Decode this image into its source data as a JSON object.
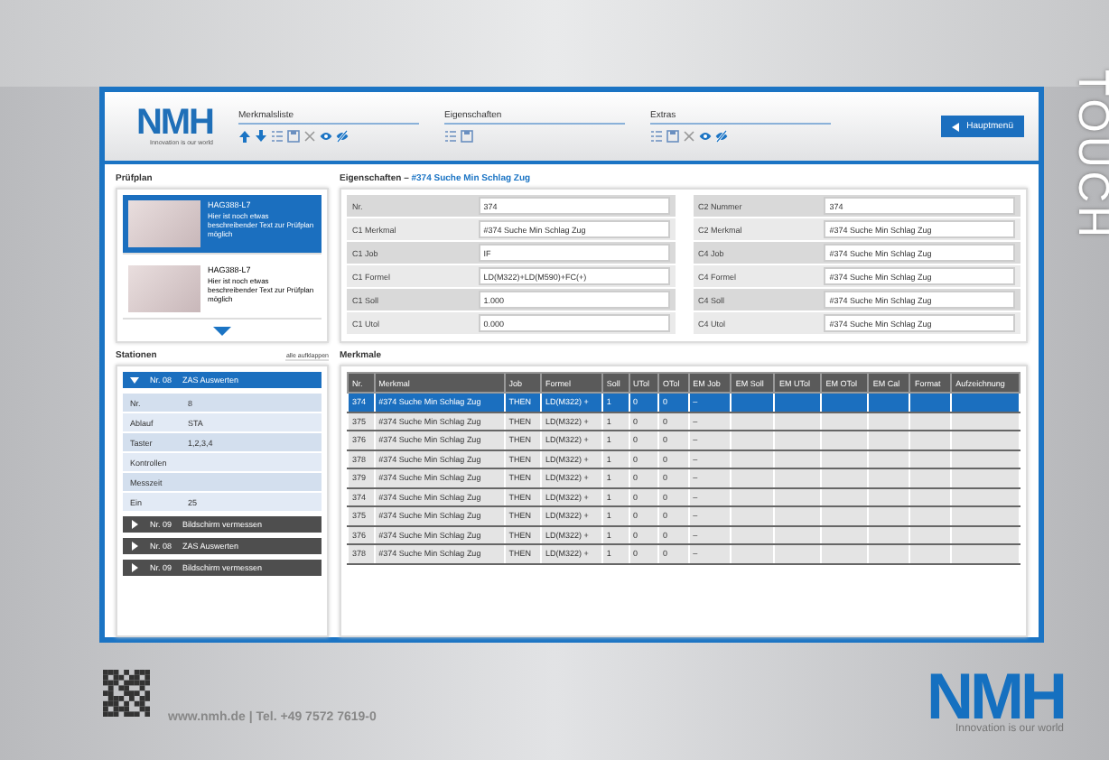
{
  "side_label": "TOUCH",
  "header": {
    "logo": "NMH",
    "tagline": "Innovation is our world",
    "groups": [
      {
        "label": "Merkmalsliste"
      },
      {
        "label": "Eigenschaften"
      },
      {
        "label": "Extras"
      }
    ],
    "main_button": "Hauptmenü"
  },
  "pruefplan": {
    "title": "Prüfplan",
    "items": [
      {
        "code": "HAG388-L7",
        "text": "Hier ist noch etwas beschreibender Text zur Prüfplan möglich",
        "selected": true
      },
      {
        "code": "HAG388-L7",
        "text": "Hier ist noch etwas beschreibender Text zur Prüfplan möglich",
        "selected": false
      }
    ]
  },
  "eigenschaften": {
    "title": "Eigenschaften – ",
    "subject": "#374 Suche Min Schlag Zug",
    "left": [
      {
        "label": "Nr.",
        "value": "374"
      },
      {
        "label": "C1 Merkmal",
        "value": "#374 Suche Min Schlag Zug"
      },
      {
        "label": "C1 Job",
        "value": "IF"
      },
      {
        "label": "C1 Formel",
        "value": "LD(M322)+LD(M590)+FC(+)"
      },
      {
        "label": "C1 Soll",
        "value": "1.000"
      },
      {
        "label": "C1 Utol",
        "value": "0.000"
      }
    ],
    "right": [
      {
        "label": "C2 Nummer",
        "value": "374"
      },
      {
        "label": "C2 Merkmal",
        "value": "#374 Suche Min Schlag Zug"
      },
      {
        "label": "C4 Job",
        "value": "#374 Suche Min Schlag Zug"
      },
      {
        "label": "C4 Formel",
        "value": "#374 Suche Min Schlag Zug"
      },
      {
        "label": "C4 Soll",
        "value": "#374 Suche Min Schlag Zug"
      },
      {
        "label": "C4 Utol",
        "value": "#374 Suche Min Schlag Zug"
      }
    ]
  },
  "stationen": {
    "title": "Stationen",
    "expand_all": "alle aufklappen",
    "items": [
      {
        "nr": "Nr. 08",
        "name": "ZAS Auswerten",
        "expanded": true,
        "details": [
          {
            "label": "Nr.",
            "value": "8"
          },
          {
            "label": "Ablauf",
            "value": "STA"
          },
          {
            "label": "Taster",
            "value": "1,2,3,4"
          },
          {
            "label": "Kontrollen"
          },
          {
            "label": "Messzeit"
          },
          {
            "label": "Ein",
            "value": "25"
          }
        ]
      },
      {
        "nr": "Nr. 09",
        "name": "Bildschirm vermessen",
        "expanded": false
      },
      {
        "nr": "Nr. 08",
        "name": "ZAS Auswerten",
        "expanded": false
      },
      {
        "nr": "Nr. 09",
        "name": "Bildschirm vermessen",
        "expanded": false
      }
    ]
  },
  "merkmale": {
    "title": "Merkmale",
    "columns": [
      "Nr.",
      "Merkmal",
      "Job",
      "Formel",
      "Soll",
      "UTol",
      "OTol",
      "EM Job",
      "EM Soll",
      "EM UTol",
      "EM OTol",
      "EM Cal",
      "Format",
      "Aufzeichnung"
    ],
    "rows": [
      {
        "cells": [
          "374",
          "#374 Suche Min Schlag Zug",
          "THEN",
          "LD(M322) +",
          "1",
          "0",
          "0",
          "–"
        ],
        "selected": true
      },
      {
        "cells": [
          "375",
          "#374 Suche Min Schlag Zug",
          "THEN",
          "LD(M322) +",
          "1",
          "0",
          "0",
          "–"
        ],
        "selected": false
      },
      {
        "cells": [
          "376",
          "#374 Suche Min Schlag Zug",
          "THEN",
          "LD(M322) +",
          "1",
          "0",
          "0",
          "–"
        ],
        "selected": false
      },
      {
        "cells": [
          "378",
          "#374 Suche Min Schlag Zug",
          "THEN",
          "LD(M322) +",
          "1",
          "0",
          "0",
          "–"
        ],
        "selected": false
      },
      {
        "cells": [
          "379",
          "#374 Suche Min Schlag Zug",
          "THEN",
          "LD(M322) +",
          "1",
          "0",
          "0",
          "–"
        ],
        "selected": false
      },
      {
        "cells": [
          "374",
          "#374 Suche Min Schlag Zug",
          "THEN",
          "LD(M322) +",
          "1",
          "0",
          "0",
          "–"
        ],
        "selected": false
      },
      {
        "cells": [
          "375",
          "#374 Suche Min Schlag Zug",
          "THEN",
          "LD(M322) +",
          "1",
          "0",
          "0",
          "–"
        ],
        "selected": false
      },
      {
        "cells": [
          "376",
          "#374 Suche Min Schlag Zug",
          "THEN",
          "LD(M322) +",
          "1",
          "0",
          "0",
          "–"
        ],
        "selected": false
      },
      {
        "cells": [
          "378",
          "#374 Suche Min Schlag Zug",
          "THEN",
          "LD(M322) +",
          "1",
          "0",
          "0",
          "–"
        ],
        "selected": false
      }
    ]
  },
  "footer": {
    "contact": "www.nmh.de | Tel. +49 7572 7619-0",
    "logo": "NMH",
    "tagline": "Innovation is our world"
  }
}
